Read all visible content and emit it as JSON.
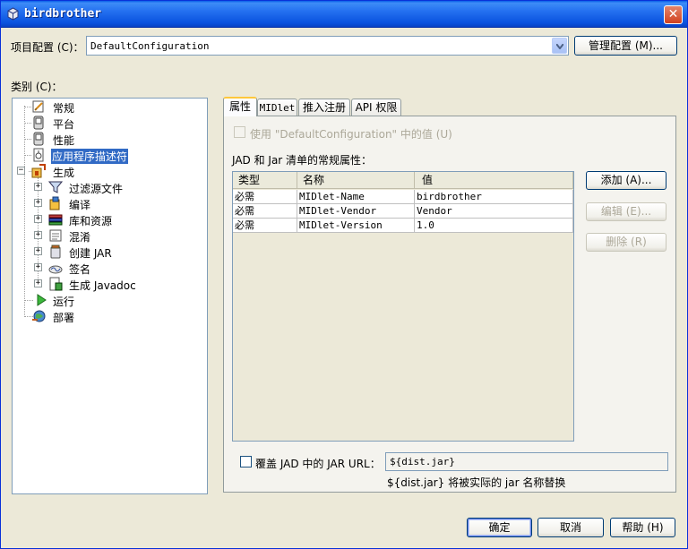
{
  "window": {
    "title": "birdbrother",
    "close_glyph": "✕"
  },
  "config": {
    "label": "项目配置 (C)：",
    "value": "DefaultConfiguration",
    "manage_button": "管理配置 (M)..."
  },
  "categories": {
    "label": "类别 (C)：",
    "items": [
      {
        "label": "常规"
      },
      {
        "label": "平台"
      },
      {
        "label": "性能"
      },
      {
        "label": "应用程序描述符"
      },
      {
        "label": "生成"
      },
      {
        "label": "过滤源文件"
      },
      {
        "label": "编译"
      },
      {
        "label": "库和资源"
      },
      {
        "label": "混淆"
      },
      {
        "label": "创建 JAR"
      },
      {
        "label": "签名"
      },
      {
        "label": "生成 Javadoc"
      },
      {
        "label": "运行"
      },
      {
        "label": "部署"
      }
    ]
  },
  "tabs": [
    {
      "label": "属性"
    },
    {
      "label": "MIDlet"
    },
    {
      "label": "推入注册"
    },
    {
      "label": "API 权限"
    }
  ],
  "use_default": {
    "label": "使用 \"DefaultConfiguration\" 中的值 (U)"
  },
  "attributes": {
    "label": "JAD 和 Jar 清单的常规属性：",
    "columns": [
      "类型",
      "名称",
      "值"
    ],
    "rows": [
      {
        "type": "必需",
        "name": "MIDlet-Name",
        "value": "birdbrother"
      },
      {
        "type": "必需",
        "name": "MIDlet-Vendor",
        "value": "Vendor"
      },
      {
        "type": "必需",
        "name": "MIDlet-Version",
        "value": "1.0"
      }
    ]
  },
  "side_buttons": {
    "add": "添加 (A)...",
    "edit": "编辑 (E)...",
    "remove": "删除 (R)"
  },
  "override": {
    "label": "覆盖 JAD 中的 JAR URL：",
    "value": "${dist.jar}",
    "hint": "${dist.jar} 将被实际的 jar 名称替换"
  },
  "footer": {
    "ok": "确定",
    "cancel": "取消",
    "help": "帮助 (H)"
  }
}
